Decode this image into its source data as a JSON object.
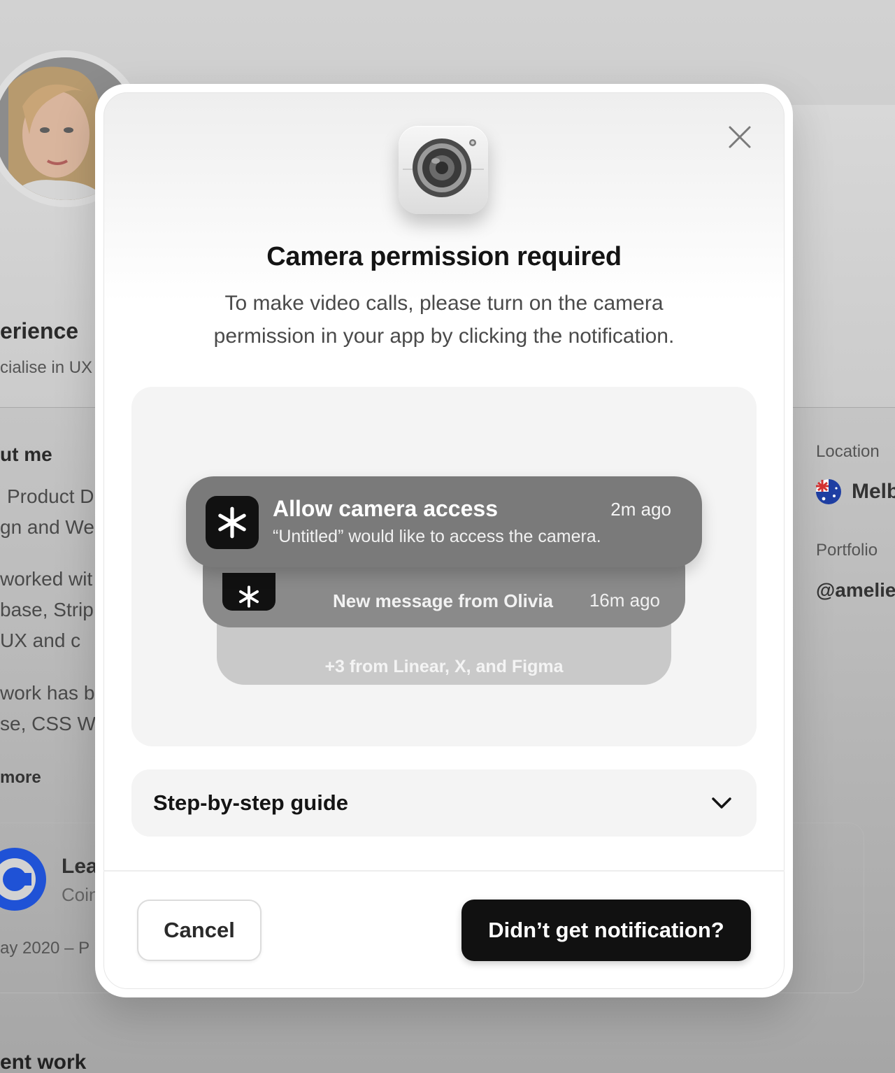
{
  "background": {
    "experience_heading": "erience",
    "experience_sub": "cialise in UX",
    "about_heading": "ut me",
    "about_lines": [
      "Product D",
      "gn and We",
      "worked wit",
      "base, Strip",
      "UX and c",
      "work has b",
      "se, CSS W"
    ],
    "read_more": "more",
    "job_title": "Lea",
    "job_company": "Coin",
    "job_dates": "ay 2020 – P",
    "recent_work_heading": "ent work",
    "location_label": "Location",
    "location_value": "Melb",
    "portfolio_label": "Portfolio",
    "portfolio_value": "@amelie",
    "icons": {
      "flag": "australia-flag-icon",
      "company": "coinbase-logo-icon"
    }
  },
  "modal": {
    "title": "Camera permission required",
    "description": "To make video calls, please turn on the camera permission in your app by clicking the notification.",
    "close_icon": "close-icon",
    "hero_icon": "camera-icon",
    "preview": {
      "notifications": [
        {
          "title": "Allow camera access",
          "body": "“Untitled” would like to access the camera.",
          "time": "2m ago",
          "icon": "asterisk-app-icon"
        },
        {
          "title": "New message from Olivia",
          "time": "16m ago",
          "icon": "asterisk-app-icon"
        },
        {
          "title": "+3 from Linear, X, and Figma"
        }
      ]
    },
    "guide_label": "Step-by-step guide",
    "guide_icon": "chevron-down-icon",
    "cancel_label": "Cancel",
    "primary_label": "Didn’t get notification?"
  },
  "colors": {
    "primary_button": "#111111",
    "notification_front": "#7a7a7a",
    "notification_mid": "#8a8a8a",
    "notification_back": "#c9c9c9",
    "panel": "#f4f4f4"
  }
}
